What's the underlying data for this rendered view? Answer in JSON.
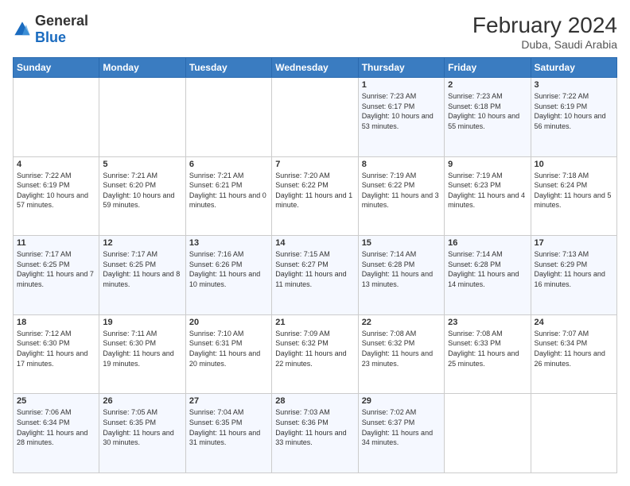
{
  "header": {
    "logo_general": "General",
    "logo_blue": "Blue",
    "month_year": "February 2024",
    "location": "Duba, Saudi Arabia"
  },
  "days_of_week": [
    "Sunday",
    "Monday",
    "Tuesday",
    "Wednesday",
    "Thursday",
    "Friday",
    "Saturday"
  ],
  "weeks": [
    [
      {
        "day": "",
        "text": ""
      },
      {
        "day": "",
        "text": ""
      },
      {
        "day": "",
        "text": ""
      },
      {
        "day": "",
        "text": ""
      },
      {
        "day": "1",
        "text": "Sunrise: 7:23 AM\nSunset: 6:17 PM\nDaylight: 10 hours and 53 minutes."
      },
      {
        "day": "2",
        "text": "Sunrise: 7:23 AM\nSunset: 6:18 PM\nDaylight: 10 hours and 55 minutes."
      },
      {
        "day": "3",
        "text": "Sunrise: 7:22 AM\nSunset: 6:19 PM\nDaylight: 10 hours and 56 minutes."
      }
    ],
    [
      {
        "day": "4",
        "text": "Sunrise: 7:22 AM\nSunset: 6:19 PM\nDaylight: 10 hours and 57 minutes."
      },
      {
        "day": "5",
        "text": "Sunrise: 7:21 AM\nSunset: 6:20 PM\nDaylight: 10 hours and 59 minutes."
      },
      {
        "day": "6",
        "text": "Sunrise: 7:21 AM\nSunset: 6:21 PM\nDaylight: 11 hours and 0 minutes."
      },
      {
        "day": "7",
        "text": "Sunrise: 7:20 AM\nSunset: 6:22 PM\nDaylight: 11 hours and 1 minute."
      },
      {
        "day": "8",
        "text": "Sunrise: 7:19 AM\nSunset: 6:22 PM\nDaylight: 11 hours and 3 minutes."
      },
      {
        "day": "9",
        "text": "Sunrise: 7:19 AM\nSunset: 6:23 PM\nDaylight: 11 hours and 4 minutes."
      },
      {
        "day": "10",
        "text": "Sunrise: 7:18 AM\nSunset: 6:24 PM\nDaylight: 11 hours and 5 minutes."
      }
    ],
    [
      {
        "day": "11",
        "text": "Sunrise: 7:17 AM\nSunset: 6:25 PM\nDaylight: 11 hours and 7 minutes."
      },
      {
        "day": "12",
        "text": "Sunrise: 7:17 AM\nSunset: 6:25 PM\nDaylight: 11 hours and 8 minutes."
      },
      {
        "day": "13",
        "text": "Sunrise: 7:16 AM\nSunset: 6:26 PM\nDaylight: 11 hours and 10 minutes."
      },
      {
        "day": "14",
        "text": "Sunrise: 7:15 AM\nSunset: 6:27 PM\nDaylight: 11 hours and 11 minutes."
      },
      {
        "day": "15",
        "text": "Sunrise: 7:14 AM\nSunset: 6:28 PM\nDaylight: 11 hours and 13 minutes."
      },
      {
        "day": "16",
        "text": "Sunrise: 7:14 AM\nSunset: 6:28 PM\nDaylight: 11 hours and 14 minutes."
      },
      {
        "day": "17",
        "text": "Sunrise: 7:13 AM\nSunset: 6:29 PM\nDaylight: 11 hours and 16 minutes."
      }
    ],
    [
      {
        "day": "18",
        "text": "Sunrise: 7:12 AM\nSunset: 6:30 PM\nDaylight: 11 hours and 17 minutes."
      },
      {
        "day": "19",
        "text": "Sunrise: 7:11 AM\nSunset: 6:30 PM\nDaylight: 11 hours and 19 minutes."
      },
      {
        "day": "20",
        "text": "Sunrise: 7:10 AM\nSunset: 6:31 PM\nDaylight: 11 hours and 20 minutes."
      },
      {
        "day": "21",
        "text": "Sunrise: 7:09 AM\nSunset: 6:32 PM\nDaylight: 11 hours and 22 minutes."
      },
      {
        "day": "22",
        "text": "Sunrise: 7:08 AM\nSunset: 6:32 PM\nDaylight: 11 hours and 23 minutes."
      },
      {
        "day": "23",
        "text": "Sunrise: 7:08 AM\nSunset: 6:33 PM\nDaylight: 11 hours and 25 minutes."
      },
      {
        "day": "24",
        "text": "Sunrise: 7:07 AM\nSunset: 6:34 PM\nDaylight: 11 hours and 26 minutes."
      }
    ],
    [
      {
        "day": "25",
        "text": "Sunrise: 7:06 AM\nSunset: 6:34 PM\nDaylight: 11 hours and 28 minutes."
      },
      {
        "day": "26",
        "text": "Sunrise: 7:05 AM\nSunset: 6:35 PM\nDaylight: 11 hours and 30 minutes."
      },
      {
        "day": "27",
        "text": "Sunrise: 7:04 AM\nSunset: 6:35 PM\nDaylight: 11 hours and 31 minutes."
      },
      {
        "day": "28",
        "text": "Sunrise: 7:03 AM\nSunset: 6:36 PM\nDaylight: 11 hours and 33 minutes."
      },
      {
        "day": "29",
        "text": "Sunrise: 7:02 AM\nSunset: 6:37 PM\nDaylight: 11 hours and 34 minutes."
      },
      {
        "day": "",
        "text": ""
      },
      {
        "day": "",
        "text": ""
      }
    ]
  ]
}
